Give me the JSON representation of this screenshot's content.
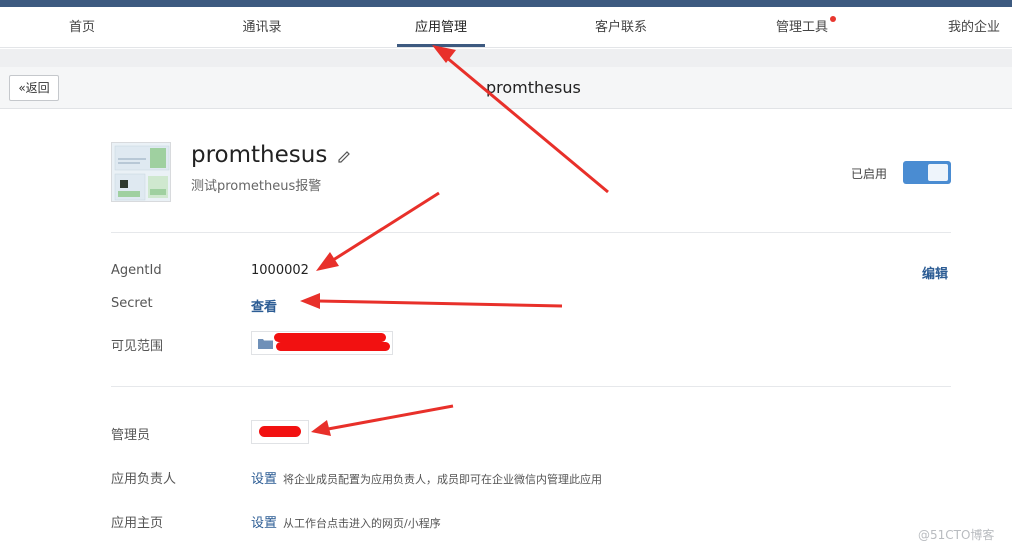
{
  "nav": {
    "items": [
      {
        "label": "首页"
      },
      {
        "label": "通讯录"
      },
      {
        "label": "应用管理"
      },
      {
        "label": "客户联系"
      },
      {
        "label": "管理工具"
      },
      {
        "label": "我的企业"
      }
    ],
    "active_index": 2
  },
  "subheader": {
    "back_label": "返回",
    "title": "promthesus"
  },
  "app": {
    "name": "promthesus",
    "description": "测试prometheus报警",
    "status_label": "已启用",
    "enabled": true
  },
  "fields": {
    "agentid_label": "AgentId",
    "agentid_value": "1000002",
    "secret_label": "Secret",
    "secret_action": "查看",
    "scope_label": "可见范围",
    "edit_label": "编辑",
    "admin_label": "管理员",
    "owner_label": "应用负责人",
    "owner_action": "设置",
    "owner_hint": "将企业成员配置为应用负责人，成员即可在企业微信内管理此应用",
    "homepage_label": "应用主页",
    "homepage_action": "设置",
    "homepage_hint": "从工作台点击进入的网页/小程序"
  },
  "watermark": "@51CTO博客",
  "colors": {
    "nav_accent": "#3d5a80",
    "link": "#2c5c94",
    "toggle_on": "#4a8cd2",
    "annotation_red": "#e8302a"
  }
}
